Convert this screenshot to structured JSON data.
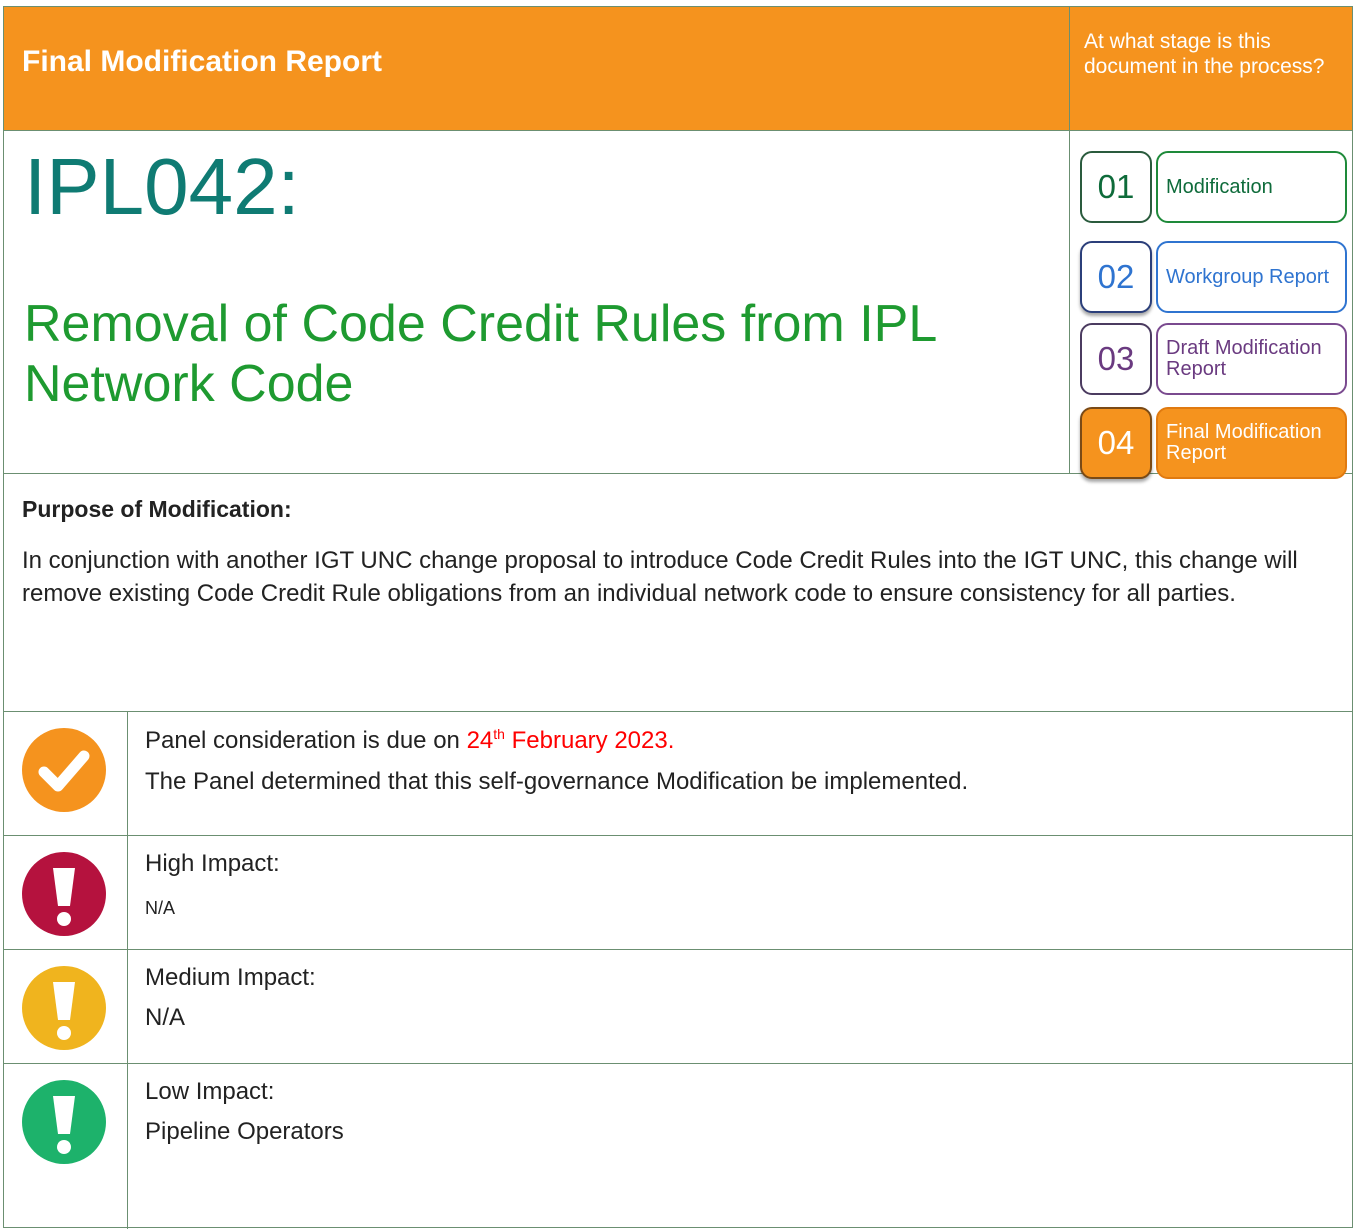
{
  "header": {
    "doc_type": "Final Modification Report",
    "stage_question": "At what stage is this document in the process?"
  },
  "modification": {
    "code": "IPL042:",
    "title": "Removal of Code Credit Rules from IPL Network Code"
  },
  "stages": [
    {
      "num": "01",
      "label": "Modification",
      "color": "#1e8a3a"
    },
    {
      "num": "02",
      "label": "Workgroup Report",
      "color": "#2f74d0"
    },
    {
      "num": "03",
      "label": "Draft Modification Report",
      "color": "#7a4a8f"
    },
    {
      "num": "04",
      "label": "Final Modification Report",
      "color": "#f5931e"
    }
  ],
  "purpose": {
    "heading": "Purpose of Modification:",
    "text": "In conjunction with another IGT UNC change proposal to introduce Code Credit Rules into the IGT UNC, this change will remove existing Code Credit Rule obligations from an individual network code to ensure consistency for all parties."
  },
  "panel": {
    "prefix": "Panel consideration is due on ",
    "date_day": "24",
    "date_sup": "th",
    "date_rest": " February 2023.",
    "determination": "The Panel determined that this self-governance Modification be implemented."
  },
  "impacts": {
    "high": {
      "label": "High Impact:",
      "value": "N/A",
      "color": "#b5123e"
    },
    "medium": {
      "label": "Medium Impact:",
      "value": "N/A",
      "color": "#f0b41e"
    },
    "low": {
      "label": "Low Impact:",
      "value": "Pipeline Operators",
      "color": "#1db26b"
    }
  },
  "accent_colors": {
    "orange": "#f5931e",
    "teal": "#0f7b73",
    "green": "#1e9a30",
    "date_red": "#ff0000"
  }
}
